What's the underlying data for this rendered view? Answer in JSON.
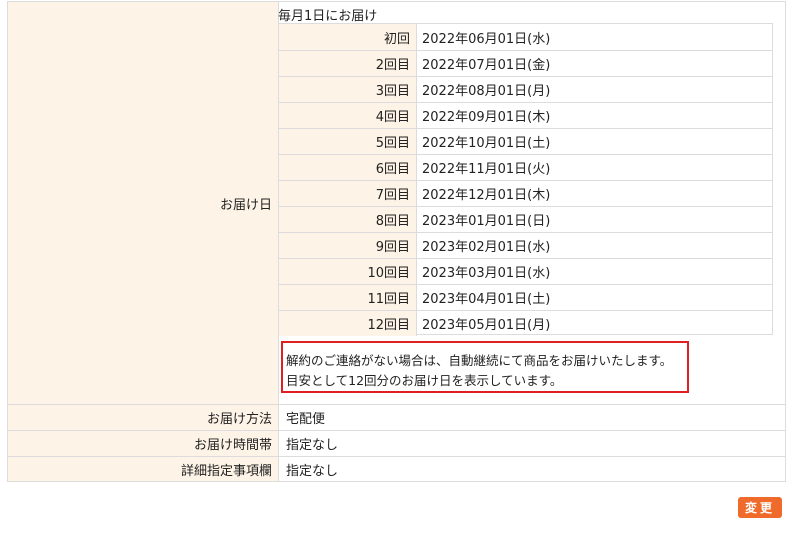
{
  "delivery_date": {
    "label": "お届け日",
    "header": "毎月1日にお届け",
    "schedule": [
      {
        "label": "初回",
        "date": "2022年06月01日(水)"
      },
      {
        "label": "2回目",
        "date": "2022年07月01日(金)"
      },
      {
        "label": "3回目",
        "date": "2022年08月01日(月)"
      },
      {
        "label": "4回目",
        "date": "2022年09月01日(木)"
      },
      {
        "label": "5回目",
        "date": "2022年10月01日(土)"
      },
      {
        "label": "6回目",
        "date": "2022年11月01日(火)"
      },
      {
        "label": "7回目",
        "date": "2022年12月01日(木)"
      },
      {
        "label": "8回目",
        "date": "2023年01月01日(日)"
      },
      {
        "label": "9回目",
        "date": "2023年02月01日(水)"
      },
      {
        "label": "10回目",
        "date": "2023年03月01日(水)"
      },
      {
        "label": "11回目",
        "date": "2023年04月01日(土)"
      },
      {
        "label": "12回目",
        "date": "2023年05月01日(月)"
      }
    ],
    "notice_line1": "解約のご連絡がない場合は、自動継続にて商品をお届けいたします。",
    "notice_line2": "目安として12回分のお届け日を表示しています。"
  },
  "delivery_method": {
    "label": "お届け方法",
    "value": "宅配便"
  },
  "delivery_time": {
    "label": "お届け時間帯",
    "value": "指定なし"
  },
  "details": {
    "label": "詳細指定事項欄",
    "value": "指定なし"
  },
  "change_button": {
    "label": "変更"
  },
  "colors": {
    "label_bg": "#fdf4e7",
    "border": "#dcdcdc",
    "notice_border": "#e02020",
    "button_bg": "#ef6a2b"
  }
}
